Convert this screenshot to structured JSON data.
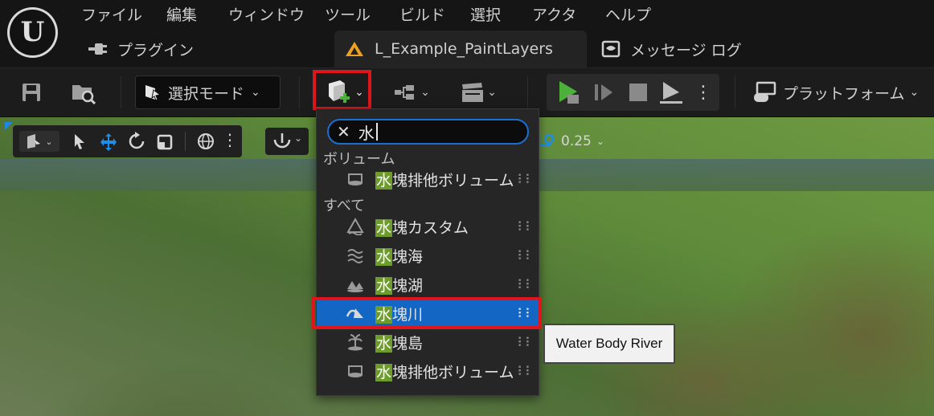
{
  "app": {
    "logo_letter": "U"
  },
  "menu": [
    "ファイル",
    "編集",
    "ウィンドウ",
    "ツール",
    "ビルド",
    "選択",
    "アクタ",
    "ヘルプ"
  ],
  "tabs": [
    {
      "label": "プラグイン",
      "icon": "plug-icon"
    },
    {
      "label": "L_Example_PaintLayers",
      "icon": "level-icon",
      "active": true
    },
    {
      "label": "メッセージ ログ",
      "icon": "message-log-icon"
    }
  ],
  "toolbar": {
    "mode_select_label": "選択モード",
    "platforms_label": "プラットフォーム",
    "play_color": "#4bb13b"
  },
  "viewport": {
    "grid_snap_value": "0.25"
  },
  "dropdown": {
    "search_value": "水",
    "sections": [
      {
        "label": "ボリューム",
        "items": [
          {
            "hit": "水",
            "rest": "塊排他ボリューム",
            "icon": "volume-icon"
          }
        ]
      },
      {
        "label": "すべて",
        "items": [
          {
            "hit": "水",
            "rest": "塊カスタム",
            "icon": "water-custom-icon"
          },
          {
            "hit": "水",
            "rest": "塊海",
            "icon": "waves-icon"
          },
          {
            "hit": "水",
            "rest": "塊湖",
            "icon": "lake-icon"
          },
          {
            "hit": "水",
            "rest": "塊川",
            "icon": "river-icon",
            "selected": true
          },
          {
            "hit": "水",
            "rest": "塊島",
            "icon": "island-icon"
          },
          {
            "hit": "水",
            "rest": "塊排他ボリューム",
            "icon": "volume-icon"
          }
        ]
      }
    ]
  },
  "tooltip": {
    "text": "Water Body River"
  },
  "colors": {
    "highlight": "#e0141b",
    "selection": "#1366c4",
    "search_hit": "#6e9c2c"
  }
}
